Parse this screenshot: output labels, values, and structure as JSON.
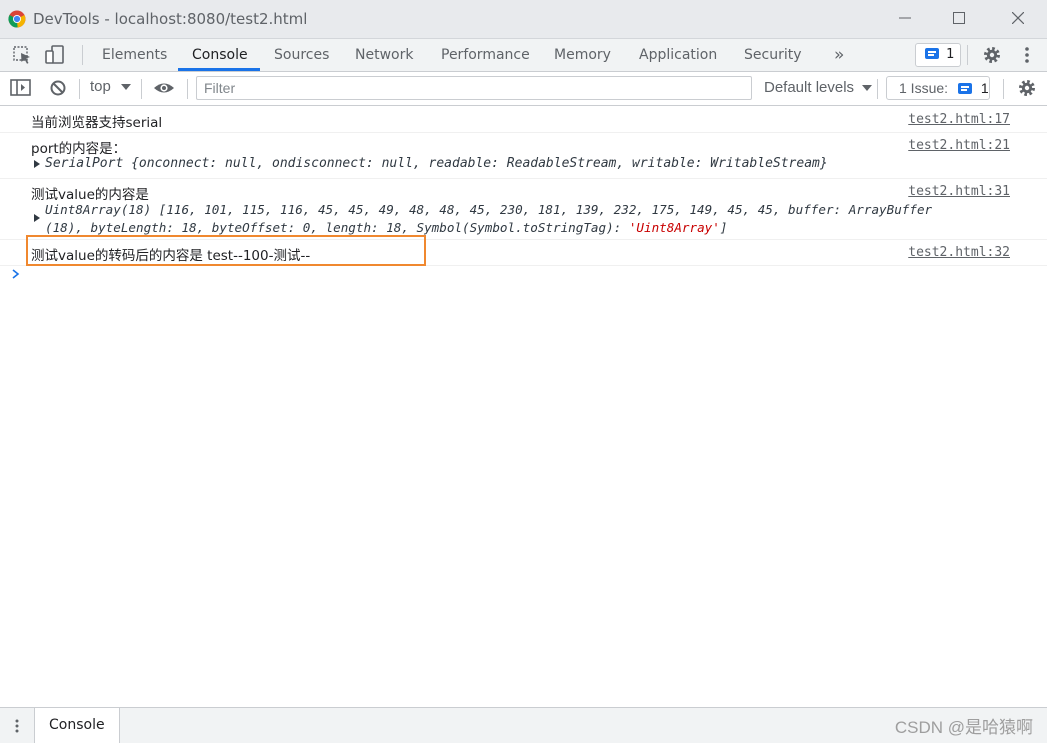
{
  "window": {
    "title": "DevTools - localhost:8080/test2.html"
  },
  "tabs": [
    {
      "label": "Elements"
    },
    {
      "label": "Console"
    },
    {
      "label": "Sources"
    },
    {
      "label": "Network"
    },
    {
      "label": "Performance"
    },
    {
      "label": "Memory"
    },
    {
      "label": "Application"
    },
    {
      "label": "Security"
    }
  ],
  "tabbar": {
    "more": "»",
    "issues_count": "1"
  },
  "toolbar": {
    "context": "top",
    "filter_placeholder": "Filter",
    "levels": "Default levels",
    "issue_label": "1 Issue:",
    "issue_count": "1"
  },
  "messages": {
    "m1": {
      "text": "当前浏览器支持serial",
      "source": "test2.html:17"
    },
    "m2": {
      "text": "port的内容是：",
      "source": "test2.html:21",
      "obj_name": "SerialPort",
      "obj_props": "{onconnect: null, ondisconnect: null, readable: ReadableStream, writable: WritableStream}"
    },
    "m3": {
      "text": "测试value的内容是",
      "source": "test2.html:31",
      "line1": "Uint8Array(18) [116, 101, 115, 116, 45, 45, 49, 48, 48, 45, 230, 181, 139, 232, 175, 149, 45, 45, buffer: ArrayBuffer",
      "line2_a": "(18), byteLength: 18, byteOffset: 0, length: 18, Symbol(Symbol.toStringTag): ",
      "line2_b": "'Uint8Array'",
      "line2_c": "]"
    },
    "m4": {
      "text": "测试value的转码后的内容是 test--100-测试--",
      "source": "test2.html:32"
    }
  },
  "drawer": {
    "tab": "Console",
    "watermark": "CSDN @是哈猿啊"
  },
  "colors": {
    "accent": "#1a73e8",
    "highlight": "#f0882f"
  }
}
